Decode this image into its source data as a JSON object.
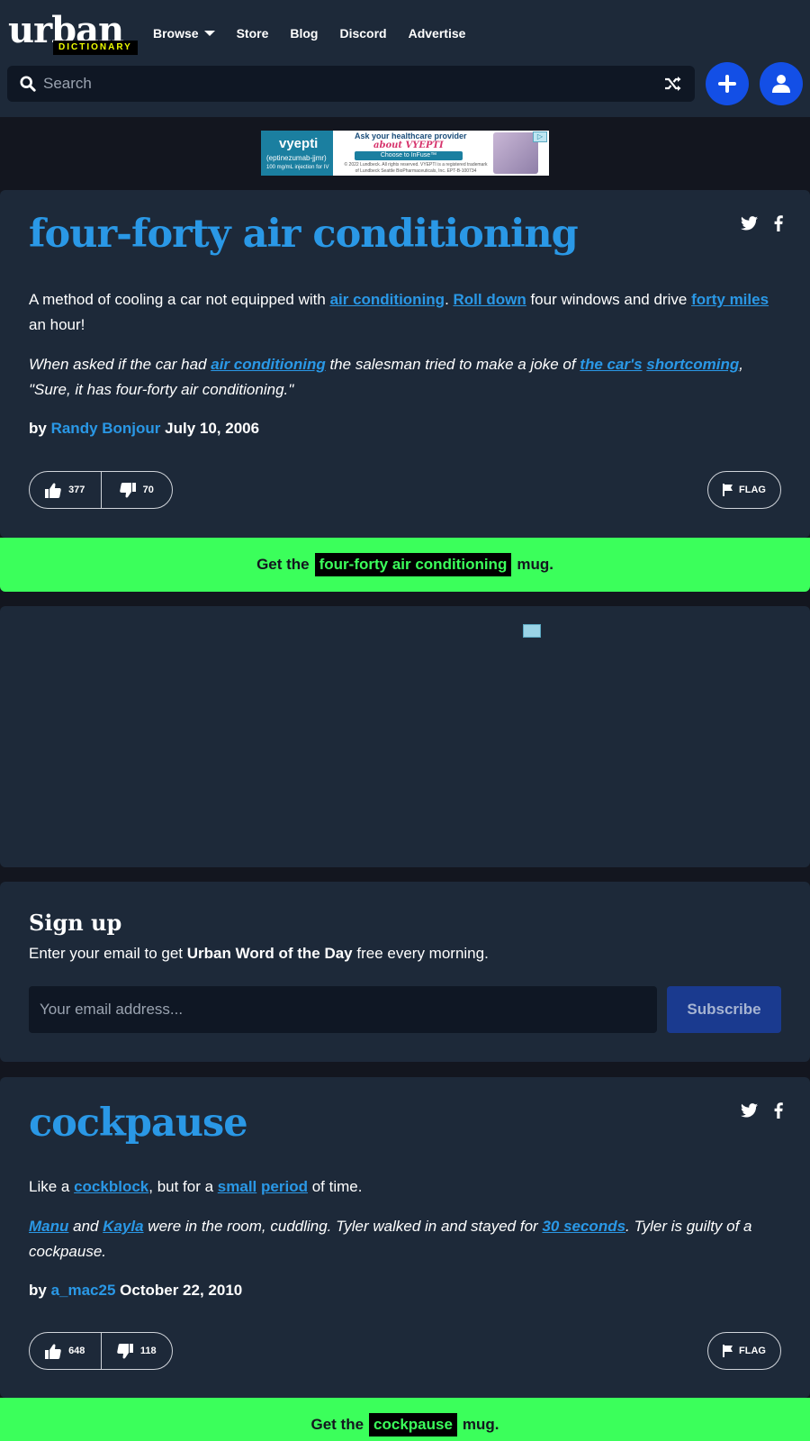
{
  "header": {
    "logo_word": "urban",
    "logo_tag": "DICTIONARY",
    "nav": [
      {
        "label": "Browse"
      },
      {
        "label": "Store"
      },
      {
        "label": "Blog"
      },
      {
        "label": "Discord"
      },
      {
        "label": "Advertise"
      }
    ],
    "search_placeholder": "Search"
  },
  "ad_top": {
    "brand": "vyepti",
    "brand_sub": "(eptinezumab-jjmr)",
    "brand_dose": "100 mg/mL injection for IV",
    "line1": "Ask your healthcare provider",
    "line2": "about VYEPTI",
    "cta": "Choose to InFuse™",
    "legal": "© 2022 Lundbeck. All rights reserved. VYEPTI is a registered trademark of Lundbeck Seattle BioPharmaceuticals, Inc. EPT-B-100734"
  },
  "definitions": [
    {
      "word": "four-forty air conditioning",
      "meaning": {
        "t1": "A method of cooling a car not equipped with ",
        "l1": "air conditioning",
        "t2": ". ",
        "l2": "Roll down",
        "t3": " four windows and drive ",
        "l3": "forty miles",
        "t4": " an hour!"
      },
      "example": {
        "t1": "When asked if the car had ",
        "l1": "air conditioning",
        "t2": " the salesman tried to make a joke of ",
        "l2": "the car's",
        "t3": " ",
        "l3": "shortcoming",
        "t4": ", \"Sure, it has four-forty air conditioning.\""
      },
      "by": "by",
      "author": "Randy Bonjour",
      "date": "July 10, 2006",
      "upvotes": "377",
      "downvotes": "70",
      "flag": "FLAG",
      "mug_prefix": "Get the",
      "mug_suffix": "mug."
    },
    {
      "word": "cockpause",
      "meaning": {
        "t1": "Like a ",
        "l1": "cockblock",
        "t2": ", but for a ",
        "l2": "small",
        "t3": " ",
        "l3": "period",
        "t4": " of time."
      },
      "example": {
        "l1": "Manu",
        "t1": " and ",
        "l2": "Kayla",
        "t2": " were in the room, cuddling. Tyler walked in and stayed for ",
        "l3": "30 seconds",
        "t3": ". Tyler is guilty of a cockpause."
      },
      "by": "by",
      "author": "a_mac25",
      "date": "October 22, 2010",
      "upvotes": "648",
      "downvotes": "118",
      "flag": "FLAG",
      "mug_prefix": "Get the",
      "mug_suffix": "mug."
    }
  ],
  "signup": {
    "title": "Sign up",
    "text_before": "Enter your email to get ",
    "text_bold": "Urban Word of the Day",
    "text_after": " free every morning.",
    "email_placeholder": "Your email address...",
    "button": "Subscribe"
  },
  "colors": {
    "background": "#13161f",
    "card": "#1d2939",
    "link": "#2a98e6",
    "mug_green": "#3bff5b",
    "button_blue": "#134fe6"
  }
}
